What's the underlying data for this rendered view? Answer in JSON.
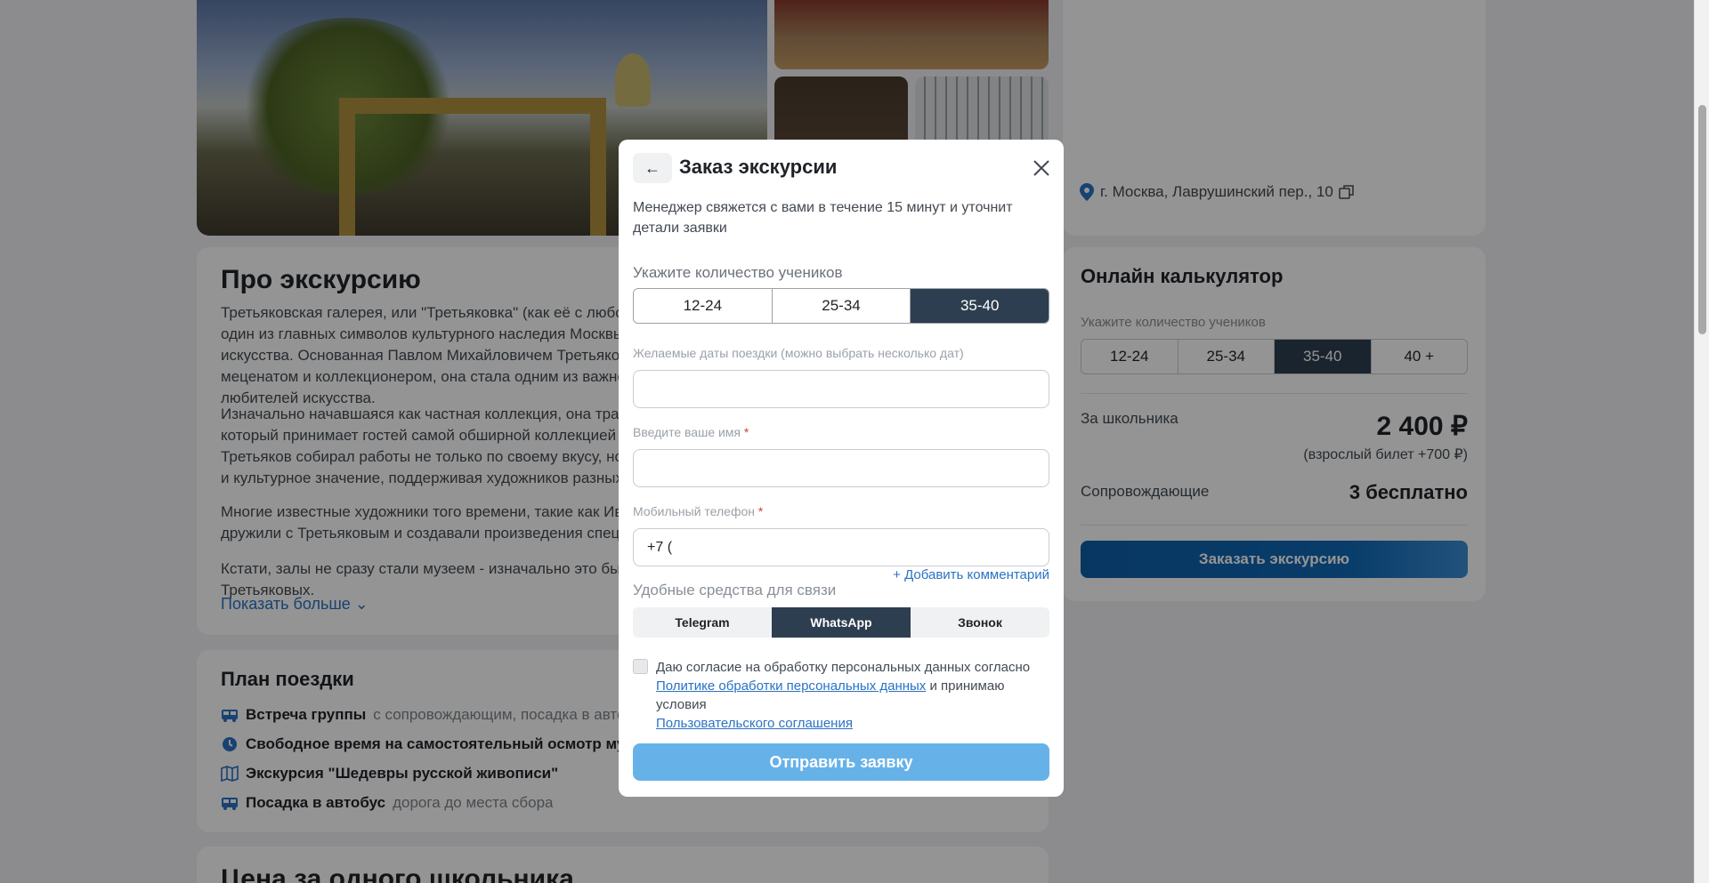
{
  "about": {
    "title": "Про экскурсию",
    "p1": "Третьяковская галерея, или \"Третьяковка\" (как её с любовью называют москвичи), — один из главных символов культурного наследия Москвы и сокровищницей русского искусства. Основанная Павлом Михайловичем Третьяковым, предпринимателем, меценатом и коллекционером, она стала одним из важнейших центров притяжения для любителей искусства.",
    "p2": "Изначально начавшаяся как частная коллекция, она трансформировалась в музей, который принимает гостей самой обширной коллекцией русской живописи в мире. Третьяков собирал работы не только по своему вкусу, но и предвидел их историческое и культурное значение, поддерживая художников разных направлений.",
    "p3": "Многие известные художники того времени, такие как Иван Крамской и Илья Репин, дружили с Третьяковым и создавали произведения специально для его коллекции.",
    "p4": "Кстати, залы не сразу стали музеем - изначально это был жилой дом семьи Третьяковых.",
    "show_more": "Показать  больше"
  },
  "plan": {
    "title": "План поездки",
    "items": [
      {
        "title": "Встреча группы",
        "sub": "с сопровождающим, посадка в автобус",
        "icon": "bus-icon"
      },
      {
        "title": "Свободное время на самостоятельный осмотр музея",
        "sub": "",
        "icon": "clock-icon"
      },
      {
        "title": "Экскурсия \"Шедевры русской живописи\"",
        "sub": "",
        "icon": "map-icon"
      },
      {
        "title": "Посадка в автобус",
        "sub": "дорога до места сбора",
        "icon": "bus-icon"
      }
    ]
  },
  "price_section": {
    "title": "Цена за одного школьника"
  },
  "address": {
    "text": "г. Москва, Лаврушинский пер., 10",
    "icon": "map-pin-icon",
    "copy_icon": "copy-icon"
  },
  "calculator": {
    "title": "Онлайн калькулятор",
    "students_label": "Укажите количество учеников",
    "options": [
      "12-24",
      "25-34",
      "35-40",
      "40 +"
    ],
    "selected": "35-40",
    "per_student_label": "За школьника",
    "per_student_value": "2 400 ₽",
    "adult_note": "(взрослый билет +700 ₽)",
    "escort_label": "Сопровождающие",
    "escort_value": "3 бесплатно",
    "order_button": "Заказать экскурсию"
  },
  "modal": {
    "back_icon": "arrow-left-icon",
    "title": "Заказ экскурсии",
    "close_icon": "close-icon",
    "description": "Менеджер свяжется с вами в течение 15 минут и уточнит детали заявки",
    "students_label": "Укажите количество учеников",
    "options": [
      "12-24",
      "25-34",
      "35-40"
    ],
    "selected": "35-40",
    "dates_label": "Желаемые даты поездки (можно выбрать несколько дат)",
    "dates_value": "",
    "name_label": "Введите ваше имя",
    "name_value": "",
    "phone_label": "Мобильный телефон",
    "phone_value": "+7 (",
    "required_mark": "*",
    "add_comment": "+ Добавить комментарий",
    "contact_label": "Удобные средства для связи",
    "contacts": [
      "Telegram",
      "WhatsApp",
      "Звонок"
    ],
    "contact_selected": "WhatsApp",
    "consent_prefix": "Даю согласие на обработку персональных данных согласно",
    "consent_link1": "Политике обработки персональных данных",
    "consent_mid": "и принимаю условия",
    "consent_link2": "Пользовательского соглашения",
    "submit": "Отправить заявку"
  },
  "colors": {
    "accent": "#2d3e50",
    "primary_button": "#1069b7",
    "submit_button": "#66b2e8",
    "link": "#2a72c4",
    "overlay": "rgba(0,0,0,0.42)"
  }
}
